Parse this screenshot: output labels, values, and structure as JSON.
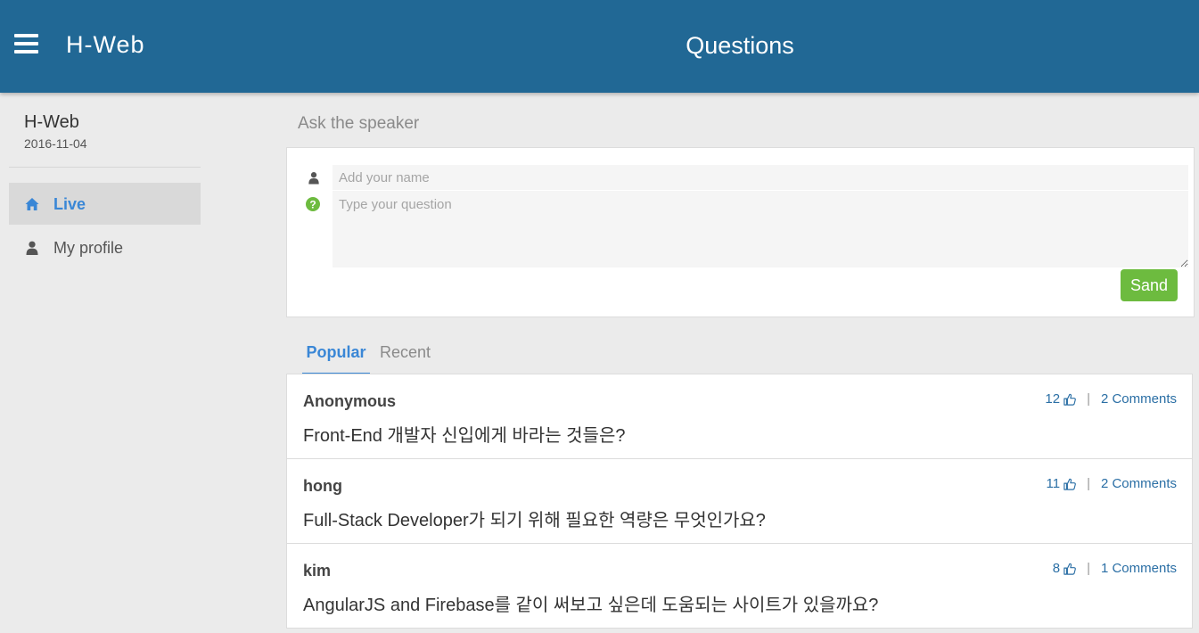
{
  "header": {
    "app_title": "H-Web",
    "page_title": "Questions"
  },
  "sidebar": {
    "event_name": "H-Web",
    "event_date": "2016-11-04",
    "items": [
      {
        "label": "Live",
        "icon": "home-icon",
        "active": true
      },
      {
        "label": "My profile",
        "icon": "user-icon",
        "active": false
      }
    ]
  },
  "ask": {
    "title": "Ask the speaker",
    "name_placeholder": "Add your name",
    "question_placeholder": "Type your question",
    "send_label": "Sand"
  },
  "tabs": [
    {
      "label": "Popular",
      "active": true
    },
    {
      "label": "Recent",
      "active": false
    }
  ],
  "questions": [
    {
      "author": "Anonymous",
      "text": "Front-End 개발자 신입에게 바라는 것들은?",
      "likes": "12",
      "comments": "2 Comments"
    },
    {
      "author": "hong",
      "text": "Full-Stack Developer가 되기 위해 필요한 역량은 무엇인가요?",
      "likes": "11",
      "comments": "2 Comments"
    },
    {
      "author": "kim",
      "text": "AngularJS and Firebase를 같이 써보고 싶은데 도움되는 사이트가 있을까요?",
      "likes": "8",
      "comments": "1 Comments"
    }
  ],
  "colors": {
    "header_bg": "#216895",
    "accent_blue": "#3a87d6",
    "send_green": "#6dbb3f",
    "question_icon_green": "#6dbb3f"
  }
}
